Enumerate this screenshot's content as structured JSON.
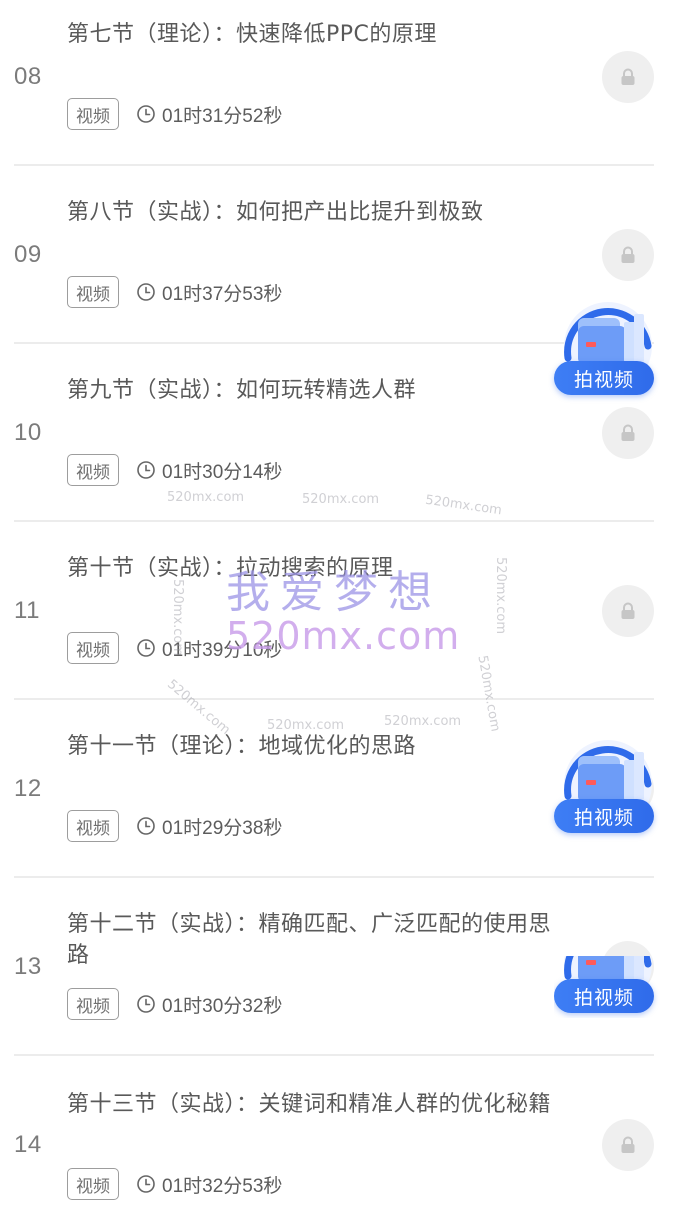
{
  "lessons": [
    {
      "num": "08",
      "title": "第七节（理论）：快速降低PPC的原理",
      "tag": "视频",
      "duration": "01时31分52秒",
      "lock_icon": "lock-icon",
      "locked": true
    },
    {
      "num": "09",
      "title": "第八节（实战）：如何把产出比提升到极致",
      "tag": "视频",
      "duration": "01时37分53秒",
      "lock_icon": "lock-icon",
      "locked": true
    },
    {
      "num": "10",
      "title": "第九节（实战）：如何玩转精选人群",
      "tag": "视频",
      "duration": "01时30分14秒",
      "lock_icon": "lock-icon",
      "locked": true
    },
    {
      "num": "11",
      "title": "第十节（实战）：拉动搜索的原理",
      "tag": "视频",
      "duration": "01时39分10秒",
      "lock_icon": "lock-icon",
      "locked": true
    },
    {
      "num": "12",
      "title": "第十一节（理论）：地域优化的思路",
      "tag": "视频",
      "duration": "01时29分38秒",
      "lock_icon": "lock-icon",
      "locked": true
    },
    {
      "num": "13",
      "title": "第十二节（实战）：精确匹配、广泛匹配的使用思路",
      "tag": "视频",
      "duration": "01时30分32秒",
      "lock_icon": "lock-icon",
      "locked": true
    },
    {
      "num": "14",
      "title": "第十三节（实战）：关键词和精准人群的优化秘籍",
      "tag": "视频",
      "duration": "01时32分53秒",
      "lock_icon": "lock-icon",
      "locked": true
    }
  ],
  "clock_icon": "clock-icon",
  "shoot_video_badges": [
    {
      "label": "拍视频",
      "icon": "video-folder-icon"
    },
    {
      "label": "拍视频",
      "icon": "video-folder-icon"
    },
    {
      "label": "拍视频",
      "icon": "video-folder-icon"
    }
  ],
  "watermark": {
    "cn": "我爱梦想",
    "domain_big": "520mx.com",
    "domain_small": "520mx.com",
    "cn_color": "#9b93e6",
    "domain_color": "#c79ae8"
  },
  "colors": {
    "badge_blue": "#2f6bea",
    "lock_bg": "#efefef",
    "divider": "#ececec"
  }
}
